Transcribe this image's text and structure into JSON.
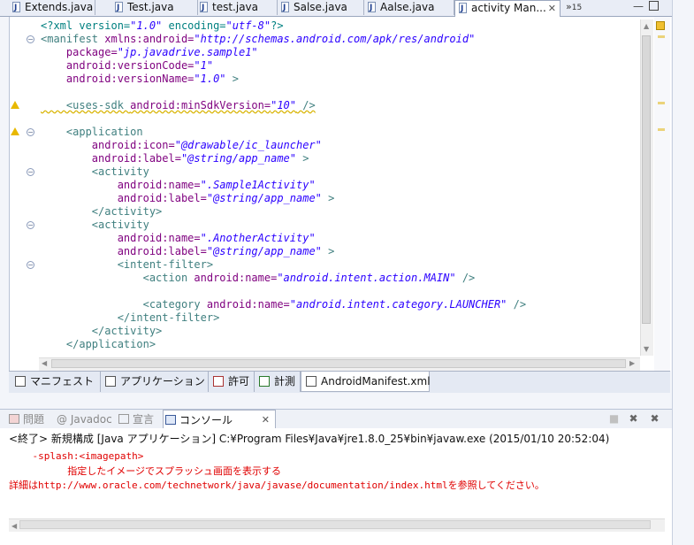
{
  "editor_tabs": [
    {
      "label": "Extends.java"
    },
    {
      "label": "Test.java"
    },
    {
      "label": "test.java"
    },
    {
      "label": "Salse.java"
    },
    {
      "label": "Aalse.java"
    },
    {
      "label": "activity Man..."
    }
  ],
  "overflow_count": "15",
  "code_lines": [
    {
      "y": 0,
      "html_parts": [
        [
          "p",
          "<?xml version="
        ],
        [
          "v",
          "\"1.0\""
        ],
        [
          "p",
          " encoding="
        ],
        [
          "v",
          "\"utf-8\""
        ],
        [
          "p",
          "?>"
        ]
      ]
    },
    {
      "y": 1,
      "html_parts": [
        [
          "t",
          "<manifest "
        ],
        [
          "a",
          "xmlns:android="
        ],
        [
          "v",
          "\"http://schemas.android.com/apk/res/android\""
        ]
      ]
    },
    {
      "y": 2,
      "html_parts": [
        [
          "a",
          "    package="
        ],
        [
          "v",
          "\"jp.javadrive.sample1\""
        ]
      ]
    },
    {
      "y": 3,
      "html_parts": [
        [
          "a",
          "    android:versionCode="
        ],
        [
          "v",
          "\"1\""
        ]
      ]
    },
    {
      "y": 4,
      "html_parts": [
        [
          "a",
          "    android:versionName="
        ],
        [
          "v",
          "\"1.0\""
        ],
        [
          "t",
          " >"
        ]
      ]
    },
    {
      "y": 6,
      "html_parts": [
        [
          "t",
          "    <uses-sdk "
        ],
        [
          "a",
          "android:minSdkVersion="
        ],
        [
          "v",
          "\"10\""
        ],
        [
          "t",
          " />"
        ]
      ]
    },
    {
      "y": 8,
      "html_parts": [
        [
          "t",
          "    <application"
        ]
      ]
    },
    {
      "y": 9,
      "html_parts": [
        [
          "a",
          "        android:icon="
        ],
        [
          "v",
          "\"@drawable/ic_launcher\""
        ]
      ]
    },
    {
      "y": 10,
      "html_parts": [
        [
          "a",
          "        android:label="
        ],
        [
          "v",
          "\"@string/app_name\""
        ],
        [
          "t",
          " >"
        ]
      ]
    },
    {
      "y": 11,
      "html_parts": [
        [
          "t",
          "        <activity"
        ]
      ]
    },
    {
      "y": 12,
      "html_parts": [
        [
          "a",
          "            android:name="
        ],
        [
          "v",
          "\".Sample1Activity\""
        ]
      ]
    },
    {
      "y": 13,
      "html_parts": [
        [
          "a",
          "            android:label="
        ],
        [
          "v",
          "\"@string/app_name\""
        ],
        [
          "t",
          " >"
        ]
      ]
    },
    {
      "y": 14,
      "html_parts": [
        [
          "t",
          "        </activity>"
        ]
      ]
    },
    {
      "y": 15,
      "html_parts": [
        [
          "t",
          "        <activity"
        ]
      ]
    },
    {
      "y": 16,
      "html_parts": [
        [
          "a",
          "            android:name="
        ],
        [
          "v",
          "\".AnotherActivity\""
        ]
      ]
    },
    {
      "y": 17,
      "html_parts": [
        [
          "a",
          "            android:label="
        ],
        [
          "v",
          "\"@string/app_name\""
        ],
        [
          "t",
          " >"
        ]
      ]
    },
    {
      "y": 18,
      "html_parts": [
        [
          "t",
          "            <intent-filter>"
        ]
      ]
    },
    {
      "y": 19,
      "html_parts": [
        [
          "t",
          "                <action "
        ],
        [
          "a",
          "android:name="
        ],
        [
          "v",
          "\"android.intent.action.MAIN\""
        ],
        [
          "t",
          " />"
        ]
      ]
    },
    {
      "y": 21,
      "html_parts": [
        [
          "t",
          "                <category "
        ],
        [
          "a",
          "android:name="
        ],
        [
          "v",
          "\"android.intent.category.LAUNCHER\""
        ],
        [
          "t",
          " />"
        ]
      ]
    },
    {
      "y": 22,
      "html_parts": [
        [
          "t",
          "            </intent-filter>"
        ]
      ]
    },
    {
      "y": 23,
      "html_parts": [
        [
          "t",
          "        </activity>"
        ]
      ]
    },
    {
      "y": 24,
      "html_parts": [
        [
          "t",
          "    </application>"
        ]
      ]
    }
  ],
  "bottom_tabs": [
    {
      "label": "マニフェスト"
    },
    {
      "label": "アプリケーション"
    },
    {
      "label": "許可"
    },
    {
      "label": "計測"
    },
    {
      "label": "AndroidManifest.xml"
    }
  ],
  "console_tabs": [
    {
      "label": "問題"
    },
    {
      "label": "@ Javadoc"
    },
    {
      "label": "宣言"
    },
    {
      "label": "コンソール"
    }
  ],
  "console": {
    "status": "<終了> 新規構成 [Java アプリケーション] C:¥Program Files¥Java¥jre1.8.0_25¥bin¥javaw.exe (2015/01/10 20:52:04)",
    "lines": [
      "    -splash:<imagepath>",
      "          指定したイメージでスプラッシュ画面を表示する",
      "詳細はhttp://www.oracle.com/technetwork/java/javase/documentation/index.htmlを参照してください。"
    ]
  },
  "colors": {
    "tag": "#3f7f7f",
    "attr": "#7f007f",
    "value": "#2a00ff",
    "error": "#e00000",
    "warning": "#e8b800"
  }
}
